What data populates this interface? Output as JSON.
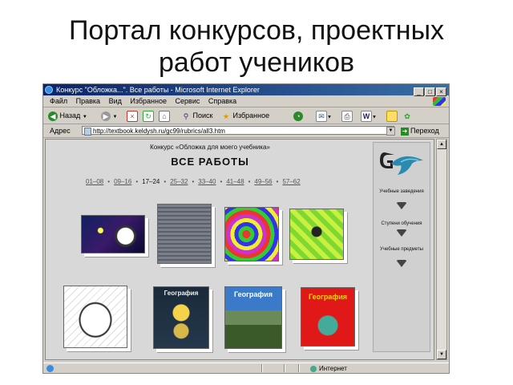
{
  "slide": {
    "title_line1": "Портал конкурсов, проектных",
    "title_line2": "работ учеников"
  },
  "window": {
    "title": "Конкурс \"Обложка...\". Все работы - Microsoft Internet Explorer",
    "controls": [
      "_",
      "□",
      "×"
    ]
  },
  "menu": [
    "Файл",
    "Правка",
    "Вид",
    "Избранное",
    "Сервис",
    "Справка"
  ],
  "toolbar": {
    "back": "Назад",
    "search": "Поиск",
    "favorites": "Избранное"
  },
  "address": {
    "label": "Адрес",
    "url": "http://textbook.keldysh.ru/gc99/rubrics/all3.htm",
    "go": "Переход"
  },
  "page": {
    "contest_title": "Конкурс «Обложка для моего учебника»",
    "heading": "ВСЕ РАБОТЫ",
    "pager": [
      "01–08",
      "09–16",
      "17–24",
      "25–32",
      "33–40",
      "41–48",
      "49–56",
      "57–62"
    ],
    "pager_current": "17–24",
    "covers": [
      {
        "caption": ""
      },
      {
        "caption": ""
      },
      {
        "caption": ""
      },
      {
        "caption": ""
      },
      {
        "caption": ""
      },
      {
        "caption": "География"
      },
      {
        "caption": "География"
      },
      {
        "caption": "География"
      }
    ]
  },
  "side": {
    "nav": [
      "Учебные заведения",
      "Ступени обучения",
      "Учебные предметы"
    ]
  },
  "status": {
    "zone": "Интернет"
  },
  "colors": {
    "titlebar": "#0a246a",
    "content_bg": "#d8d8d8",
    "window_bg": "#d4d0c8"
  }
}
